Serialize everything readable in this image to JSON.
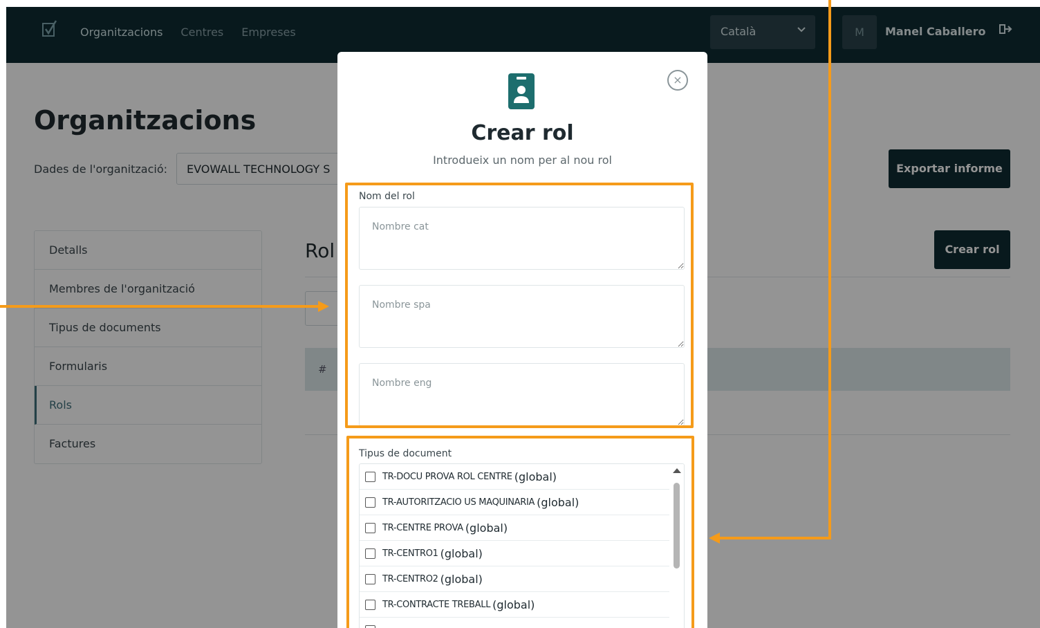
{
  "nav": {
    "links": [
      "Organitzacions",
      "Centres",
      "Empreses"
    ],
    "language": "Català",
    "avatar_initial": "M",
    "user_name": "Manel Caballero"
  },
  "page": {
    "title": "Organitzacions",
    "org_label": "Dades de l'organització:",
    "org_value": "EVOWALL TECHNOLOGY S",
    "export_button": "Exportar informe",
    "create_role_button": "Crear rol",
    "section_title": "Rol",
    "table_hash": "#"
  },
  "sidebar": {
    "items": [
      "Detalls",
      "Membres de l'organització",
      "Tipus de documents",
      "Formularis",
      "Rols",
      "Factures"
    ]
  },
  "modal": {
    "title": "Crear rol",
    "subtitle": "Introdueix un nom per al nou rol",
    "close_symbol": "×",
    "nom_label": "Nom del rol",
    "placeholders": {
      "cat": "Nombre cat",
      "spa": "Nombre spa",
      "eng": "Nombre eng"
    },
    "tipus_label": "Tipus de document",
    "documents": [
      {
        "name": "TR-DOCU PROVA ROL CENTRE",
        "scope": "(global)"
      },
      {
        "name": "TR-AUTORITZACIO US MAQUINARIA",
        "scope": "(global)"
      },
      {
        "name": "TR-CENTRE PROVA",
        "scope": "(global)"
      },
      {
        "name": "TR-CENTRO1",
        "scope": "(global)"
      },
      {
        "name": "TR-CENTRO2",
        "scope": "(global)"
      },
      {
        "name": "TR-CONTRACTE TREBALL",
        "scope": "(global)"
      }
    ]
  },
  "colors": {
    "nav_bg": "#0f2b33",
    "accent": "#1d6e6e",
    "annotation": "#f59b1a"
  }
}
